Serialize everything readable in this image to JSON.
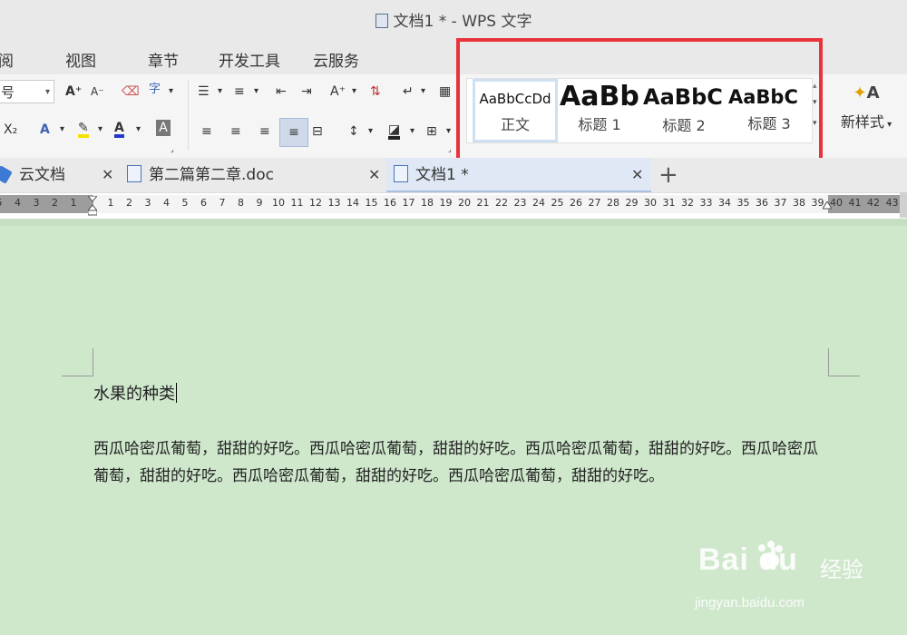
{
  "window": {
    "title": "文档1 * - WPS 文字"
  },
  "menu": [
    "阅",
    "视图",
    "章节",
    "开发工具",
    "云服务"
  ],
  "toolbar": {
    "font_size": "号",
    "format_btn_label": "字",
    "sub_label": "X₂",
    "font_color_label": "A",
    "grow_label": "A⁺",
    "shrink_label": "A⁻",
    "text_effects_label": "A",
    "shading_label": "A"
  },
  "styles": {
    "items": [
      {
        "sample": "AaBbCcDd",
        "label": "正文"
      },
      {
        "sample": "AaBb",
        "label": "标题 1"
      },
      {
        "sample": "AaBbC",
        "label": "标题 2"
      },
      {
        "sample": "AaBbC",
        "label": "标题 3"
      }
    ],
    "new_style_label": "新样式"
  },
  "tabs": [
    {
      "label": "云文档"
    },
    {
      "label": "第二篇第二章.doc"
    },
    {
      "label": "文档1 *"
    }
  ],
  "ruler": {
    "left_numbers": [
      "6",
      "5",
      "4",
      "3",
      "2",
      "1"
    ],
    "right_numbers": [
      "1",
      "2",
      "3",
      "4",
      "5",
      "6",
      "7",
      "8",
      "9",
      "10",
      "11",
      "12",
      "13",
      "14",
      "15",
      "16",
      "17",
      "18",
      "19",
      "20",
      "21",
      "22",
      "23",
      "24",
      "25",
      "26",
      "27",
      "28",
      "29",
      "30",
      "31",
      "32",
      "33",
      "34",
      "35",
      "36",
      "37",
      "38",
      "39",
      "40",
      "41",
      "42",
      "43"
    ]
  },
  "document": {
    "heading": "水果的种类",
    "paragraph": "西瓜哈密瓜葡萄，甜甜的好吃。西瓜哈密瓜葡萄，甜甜的好吃。西瓜哈密瓜葡萄，甜甜的好吃。西瓜哈密瓜葡萄，甜甜的好吃。西瓜哈密瓜葡萄，甜甜的好吃。西瓜哈密瓜葡萄，甜甜的好吃。"
  },
  "watermark": {
    "logo": "Bai  du",
    "brand": "经验",
    "url": "jingyan.baidu.com"
  },
  "colors": {
    "highlight": "#e8333b",
    "page_bg": "#cfe8cc"
  }
}
